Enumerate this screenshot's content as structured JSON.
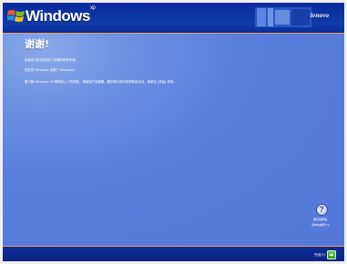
{
  "header": {
    "brand": "Windows",
    "trademark": "xp",
    "oem_logo": "lenovo"
  },
  "main": {
    "title": "谢谢!",
    "lines": [
      "恭喜您!您已经完成了设置的所有步骤。",
      "现在您 Windows 设置了 Windows。",
      "要了解 Windows XP 帮助和入门的特性，请使用产品摘要。要获得计算机的帮助和支持，请单击 [开始] 菜单。"
    ]
  },
  "help": {
    "icon": "question-icon",
    "lines": [
      "要获得帮助，",
      "请单击或按 F1。"
    ]
  },
  "footer": {
    "next_label": "完成(F)",
    "next_icon": "arrow-right-icon"
  },
  "colors": {
    "bar": "#0c2c9c",
    "content": "#5a7edc",
    "accent_line": "#e8a04a",
    "next_button": "#3aa82f"
  }
}
